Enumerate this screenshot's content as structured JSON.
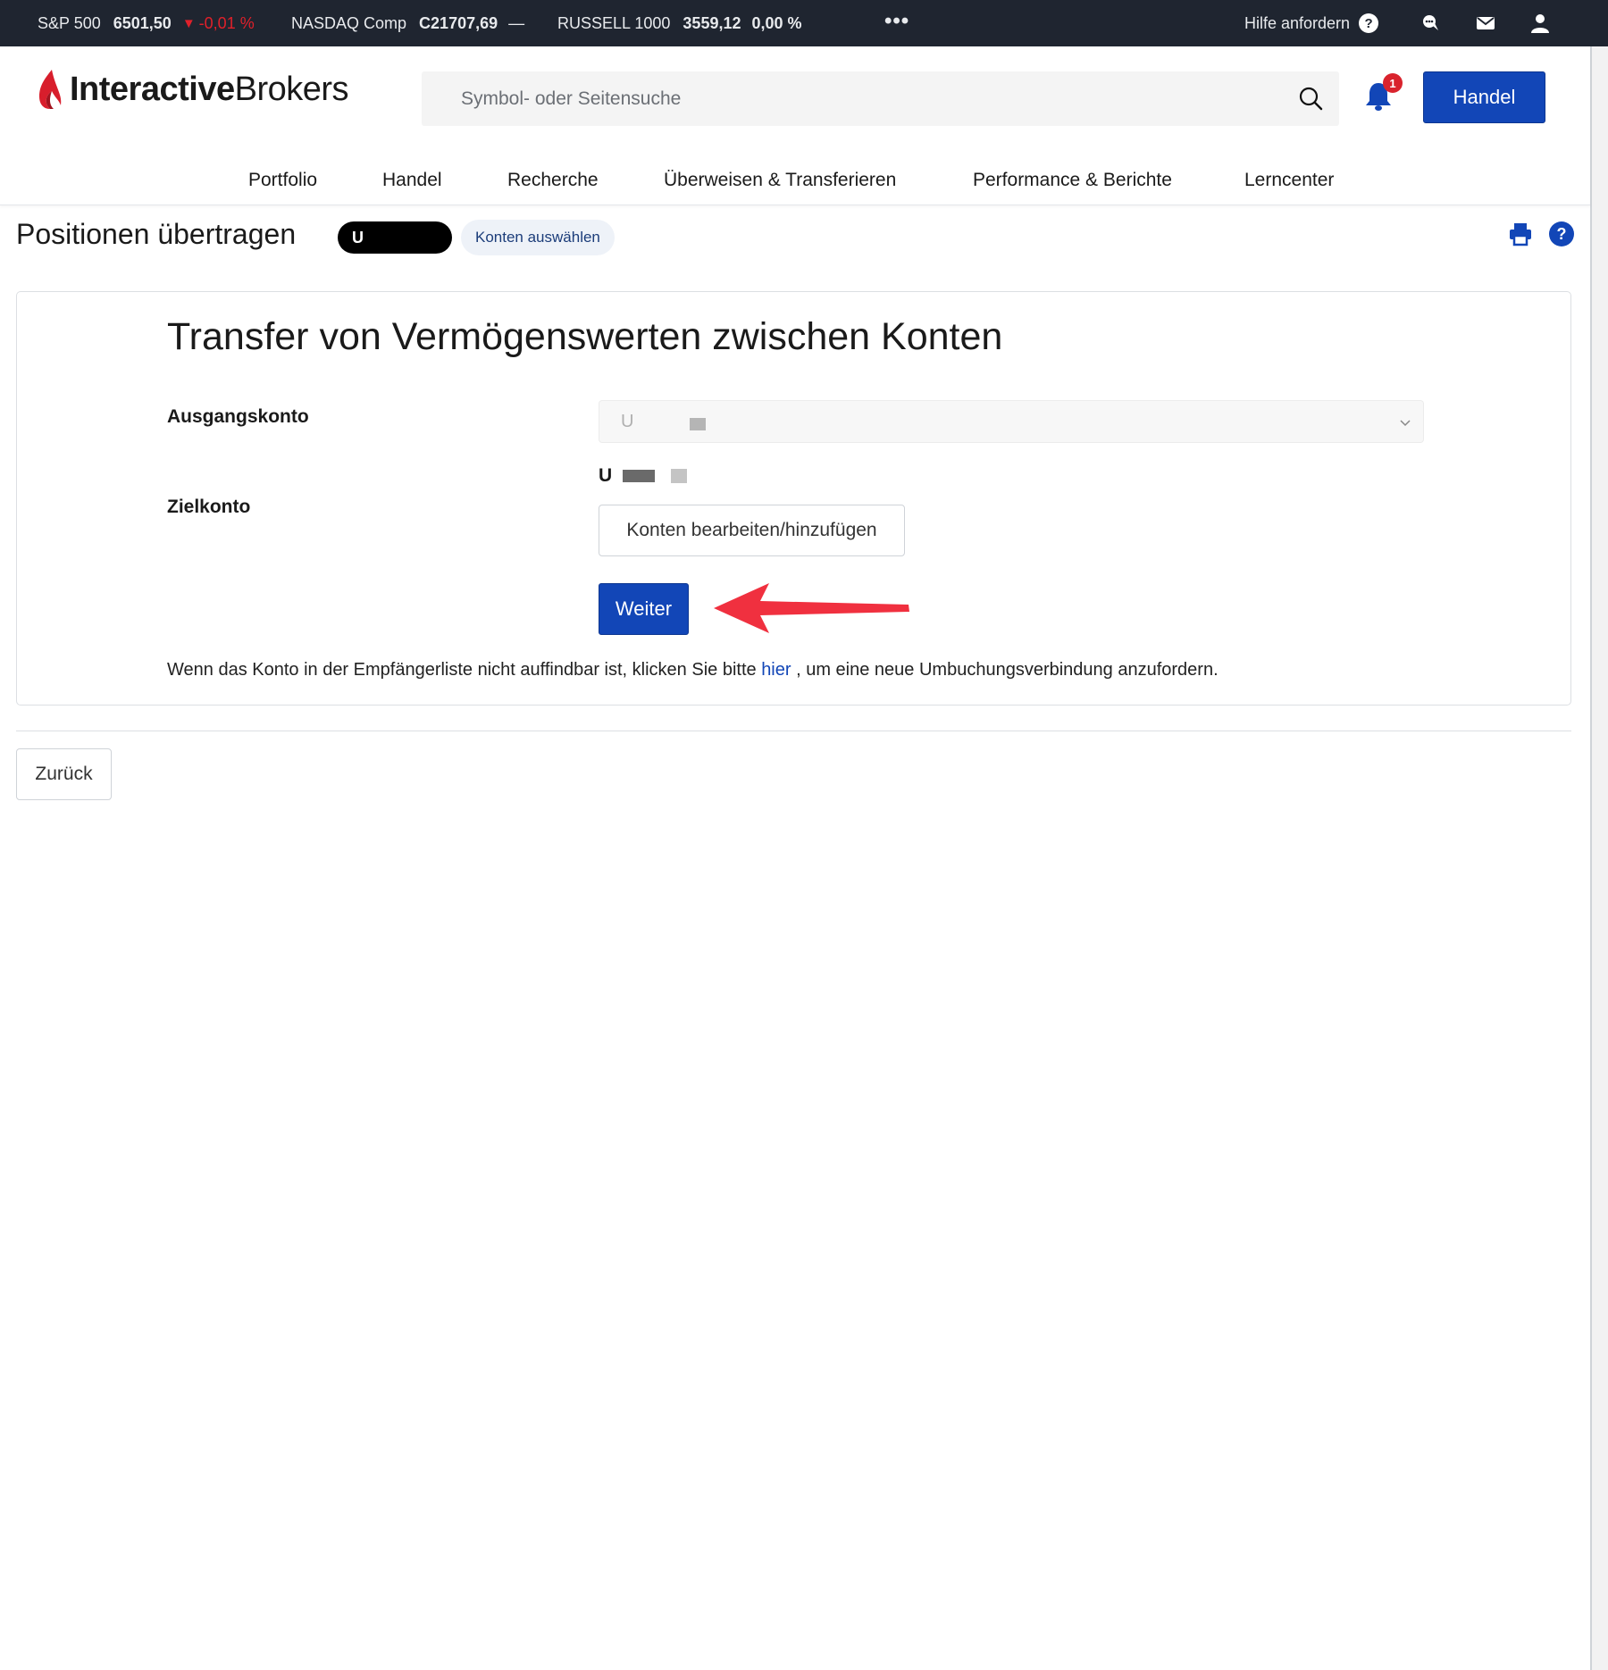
{
  "ticker": {
    "items": [
      {
        "name": "S&P 500",
        "value": "6501,50",
        "change": "-0,01 %",
        "direction": "down"
      },
      {
        "name": "NASDAQ Comp",
        "value": "C21707,69",
        "change": "—",
        "direction": "flat"
      },
      {
        "name": "RUSSELL 1000",
        "value": "3559,12",
        "change": "0,00 %",
        "direction": "flat"
      }
    ],
    "more": "•••",
    "help_label": "Hilfe anfordern",
    "help_glyph": "?"
  },
  "header": {
    "logo_bold": "Interactive",
    "logo_regular": "Brokers",
    "search_placeholder": "Symbol- oder Seitensuche",
    "notification_count": "1",
    "trade_button": "Handel"
  },
  "nav": {
    "items": [
      "Portfolio",
      "Handel",
      "Recherche",
      "Überweisen & Transferieren",
      "Performance & Berichte",
      "Lerncenter"
    ]
  },
  "page": {
    "title": "Positionen übertragen",
    "account_pill": "U",
    "select_accounts": "Konten auswählen",
    "help_glyph": "?"
  },
  "card": {
    "heading": "Transfer von Vermögenswerten zwischen Konten",
    "from_label": "Ausgangskonto",
    "from_value": "U",
    "to_label": "Zielkonto",
    "to_value": "U",
    "edit_button": "Konten bearbeiten/hinzufügen",
    "next_button": "Weiter",
    "note_before": "Wenn das Konto in der Empfängerliste nicht auffindbar ist, klicken Sie bitte ",
    "note_link": "hier",
    "note_after": " , um eine neue Umbuchungsverbindung anzufordern."
  },
  "footer": {
    "back_button": "Zurück"
  },
  "colors": {
    "brand_blue": "#1246b7",
    "ticker_bg": "#1f2530",
    "negative": "#e0202a",
    "logo_red": "#d81e2c",
    "annotation_arrow": "#f0303f"
  }
}
